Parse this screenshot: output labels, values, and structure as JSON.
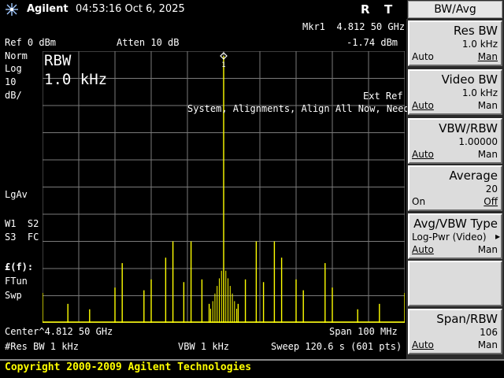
{
  "header": {
    "brand": "Agilent",
    "clock": "04:53:16  Oct 6, 2025",
    "flag_r": "R",
    "flag_t": "T"
  },
  "annotations": {
    "ref_level": "Ref 0 dBm",
    "atten": "Atten 10 dB",
    "marker_label": "Mkr1  4.812 50 GHz",
    "marker_value": "-1.74 dBm",
    "left_lines": [
      "Norm",
      "Log",
      "10",
      "dB/"
    ],
    "rbw_title": "RBW",
    "rbw_value": "1.0 kHz",
    "ext_ref": "Ext Ref",
    "alert": "System, Alignments, Align All Now, Needed",
    "lgav": "LgAv",
    "w1s2": "W1  S2",
    "s3fc": "S3  FC",
    "ff": "£(f):",
    "ftun": "FTun",
    "swp": "Swp",
    "center": "Center^4.812 50 GHz",
    "span": "Span 100 MHz",
    "res_bw": "#Res BW 1 kHz",
    "vbw": "VBW 1 kHz",
    "sweep": "Sweep 120.6 s (601 pts)",
    "marker_number": "1"
  },
  "menu": {
    "title": "BW/Avg",
    "keys": [
      {
        "title": "Res BW",
        "value": "1.0 kHz",
        "left": "Auto",
        "right": "Man"
      },
      {
        "title": "Video BW",
        "value": "1.0 kHz",
        "left": "Auto",
        "right": "Man"
      },
      {
        "title": "VBW/RBW",
        "value": "1.00000",
        "left": "Auto",
        "right": "Man"
      },
      {
        "title": "Average",
        "value": "20",
        "left": "On",
        "right": "Off"
      },
      {
        "title": "Avg/VBW Type",
        "value": "Log-Pwr (Video)",
        "arrow": "▸",
        "left": "Auto",
        "right": "Man"
      },
      {
        "title": "",
        "value": "",
        "left": "",
        "right": ""
      },
      {
        "title": "Span/RBW",
        "value": "106",
        "left": "Auto",
        "right": "Man"
      }
    ]
  },
  "footer": {
    "copyright": "Copyright 2000-2009 Agilent Technologies"
  },
  "colors": {
    "trace": "#ffff00",
    "grid": "#7a7a7a",
    "softkey": "#dcdcdc"
  },
  "chart_data": {
    "type": "line",
    "center_ghz": 4.8125,
    "span_mhz": 100,
    "ref_dbm": 0,
    "scale_db_per_div": 10,
    "ylim": [
      -100,
      0
    ],
    "xlim": [
      -50,
      50
    ],
    "grid": true,
    "marker": {
      "x_mhz": 0,
      "y_dbm": -1.74
    },
    "peaks": [
      {
        "x": -50,
        "y": -89
      },
      {
        "x": -43,
        "y": -93
      },
      {
        "x": -37,
        "y": -95
      },
      {
        "x": -30,
        "y": -87
      },
      {
        "x": -28,
        "y": -78
      },
      {
        "x": -22,
        "y": -88
      },
      {
        "x": -20,
        "y": -84
      },
      {
        "x": -16,
        "y": -76
      },
      {
        "x": -14,
        "y": -70
      },
      {
        "x": -11,
        "y": -85
      },
      {
        "x": -9,
        "y": -70
      },
      {
        "x": -6,
        "y": -84
      },
      {
        "x": -4,
        "y": -93
      },
      {
        "x": 0,
        "y": -1.74
      },
      {
        "x": 4,
        "y": -93
      },
      {
        "x": 6,
        "y": -84
      },
      {
        "x": 9,
        "y": -70
      },
      {
        "x": 11,
        "y": -85
      },
      {
        "x": 14,
        "y": -70
      },
      {
        "x": 16,
        "y": -76
      },
      {
        "x": 20,
        "y": -84
      },
      {
        "x": 22,
        "y": -88
      },
      {
        "x": 28,
        "y": -78
      },
      {
        "x": 30,
        "y": -87
      },
      {
        "x": 37,
        "y": -95
      },
      {
        "x": 43,
        "y": -93
      },
      {
        "x": 50,
        "y": -89
      }
    ]
  }
}
